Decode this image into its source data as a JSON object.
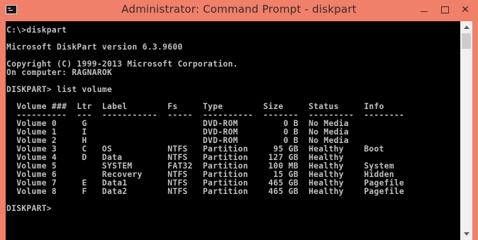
{
  "window": {
    "title": "Administrator: Command Prompt - diskpart",
    "minimize_glyph": "—",
    "close_glyph": "✕"
  },
  "colors": {
    "frame": "#f0806a",
    "console_bg": "#000000",
    "console_fg": "#c0c0c0"
  },
  "icons": {
    "app": "console-icon",
    "minimize": "minimize-icon",
    "maximize": "maximize-icon",
    "close": "close-icon",
    "scroll_up": "scroll-up-arrow-icon",
    "scroll_down": "scroll-down-arrow-icon"
  },
  "console": {
    "lines": [
      "C:\\>diskpart",
      "",
      "Microsoft DiskPart version 6.3.9600",
      "",
      "Copyright (C) 1999-2013 Microsoft Corporation.",
      "On computer: RAGNAROK",
      "",
      "DISKPART> list volume",
      "",
      "  Volume ###  Ltr  Label        Fs     Type        Size     Status     Info",
      "  ----------  ---  -----------  -----  ----------  -------  ---------  --------",
      "  Volume 0     G                       DVD-ROM         0 B  No Media",
      "  Volume 1     I                       DVD-ROM         0 B  No Media",
      "  Volume 2     H                       DVD-ROM         0 B  No Media",
      "  Volume 3     C   OS           NTFS   Partition     95 GB  Healthy    Boot",
      "  Volume 4     D   Data         NTFS   Partition    127 GB  Healthy",
      "  Volume 5         SYSTEM       FAT32  Partition    100 MB  Healthy    System",
      "  Volume 6         Recovery     NTFS   Partition     15 GB  Healthy    Hidden",
      "  Volume 7     E   Data1        NTFS   Partition    465 GB  Healthy    Pagefile",
      "  Volume 8     F   Data2        NTFS   Partition    465 GB  Healthy    Pagefile",
      "",
      "DISKPART> "
    ]
  }
}
